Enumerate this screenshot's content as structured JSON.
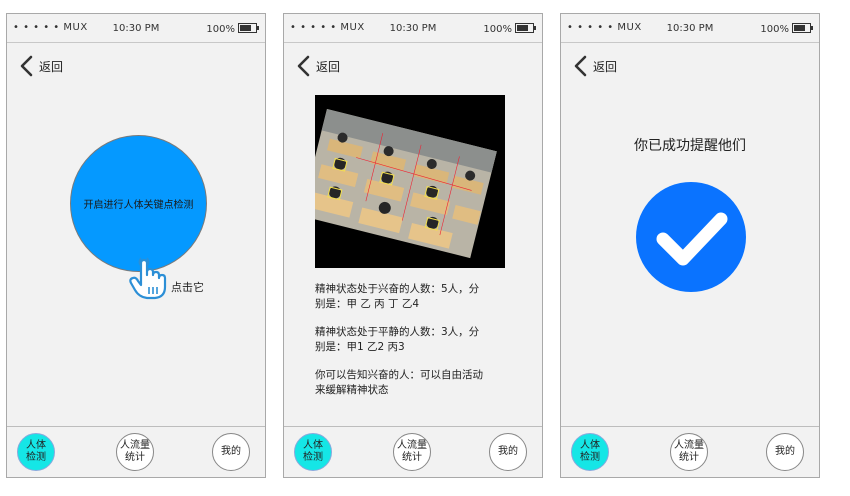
{
  "screens": [
    {
      "status": {
        "carrier": "• • • • • MUX",
        "time": "10:30 PM",
        "battery": "100%"
      },
      "back_label": "返回",
      "start_button_label": "开启进行人体关键点检测",
      "tap_hint": "点击它",
      "tabs": [
        {
          "label_line1": "人体",
          "label_line2": "检测",
          "active": true
        },
        {
          "label_line1": "人流量",
          "label_line2": "统计",
          "active": false
        },
        {
          "label_line1": "我的",
          "label_line2": "",
          "active": false
        }
      ]
    },
    {
      "status": {
        "carrier": "• • • • • MUX",
        "time": "10:30 PM",
        "battery": "100%"
      },
      "back_label": "返回",
      "result": {
        "excited_line1": "精神状态处于兴奋的人数：5人，分",
        "excited_line2": "别是：甲 乙 丙 丁 乙4",
        "calm_line1": "精神状态处于平静的人数：3人，分",
        "calm_line2": "别是：甲1 乙2 丙3",
        "advice_line1": "你可以告知兴奋的人：可以自由活动",
        "advice_line2": "来缓解精神状态"
      },
      "tabs": [
        {
          "label_line1": "人体",
          "label_line2": "检测",
          "active": true
        },
        {
          "label_line1": "人流量",
          "label_line2": "统计",
          "active": false
        },
        {
          "label_line1": "我的",
          "label_line2": "",
          "active": false
        }
      ]
    },
    {
      "status": {
        "carrier": "• • • • • MUX",
        "time": "10:30 PM",
        "battery": "100%"
      },
      "back_label": "返回",
      "success_text": "你已成功提醒他们",
      "tabs": [
        {
          "label_line1": "人体",
          "label_line2": "检测",
          "active": true
        },
        {
          "label_line1": "人流量",
          "label_line2": "统计",
          "active": false
        },
        {
          "label_line1": "我的",
          "label_line2": "",
          "active": false
        }
      ]
    }
  ],
  "colors": {
    "primary_button": "#0599ff",
    "active_tab": "#15e6e6",
    "check_circle": "#0a73ff"
  },
  "icons": [
    "back-chevron-icon",
    "pointing-hand-icon",
    "battery-icon",
    "checkmark-icon"
  ]
}
